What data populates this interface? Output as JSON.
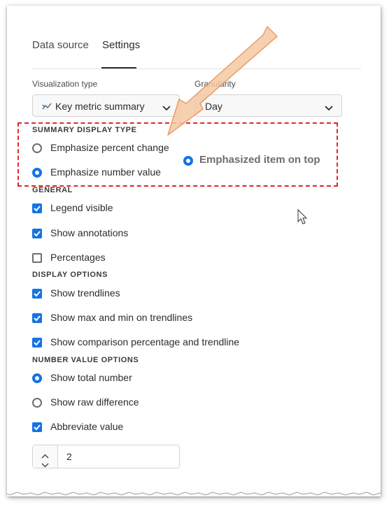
{
  "tabs": [
    {
      "label": "Data source",
      "active": false
    },
    {
      "label": "Settings",
      "active": true
    }
  ],
  "visualization_type": {
    "label": "Visualization type",
    "value": "Key metric summary",
    "icon": "trend-chart-icon"
  },
  "granularity": {
    "label": "Granularity",
    "value": "Day"
  },
  "summary_display_type": {
    "heading": "SUMMARY DISPLAY TYPE",
    "options": [
      {
        "label": "Emphasize percent change",
        "selected": false
      },
      {
        "label": "Emphasize number value",
        "selected": true
      }
    ]
  },
  "annotation": {
    "label": "Emphasized item on top",
    "callout_color": "#e0262b",
    "arrow_color": "#f0a66a"
  },
  "general": {
    "heading": "GENERAL",
    "options": [
      {
        "label": "Legend visible",
        "checked": true
      },
      {
        "label": "Show annotations",
        "checked": true
      },
      {
        "label": "Percentages",
        "checked": false
      }
    ]
  },
  "display_options": {
    "heading": "DISPLAY OPTIONS",
    "options": [
      {
        "label": "Show trendlines",
        "checked": true
      },
      {
        "label": "Show max and min on trendlines",
        "checked": true
      },
      {
        "label": "Show comparison percentage and trendline",
        "checked": true
      }
    ]
  },
  "number_value_options": {
    "heading": "NUMBER VALUE OPTIONS",
    "options": [
      {
        "label": "Show total number",
        "type": "radio",
        "selected": true
      },
      {
        "label": "Show raw difference",
        "type": "radio",
        "selected": false
      },
      {
        "label": "Abbreviate value",
        "type": "checkbox",
        "checked": true
      }
    ]
  },
  "stepper": {
    "value": "2"
  },
  "colors": {
    "accent": "#1473e6",
    "text": "#2c2c2c",
    "border": "#d3d3d3"
  }
}
